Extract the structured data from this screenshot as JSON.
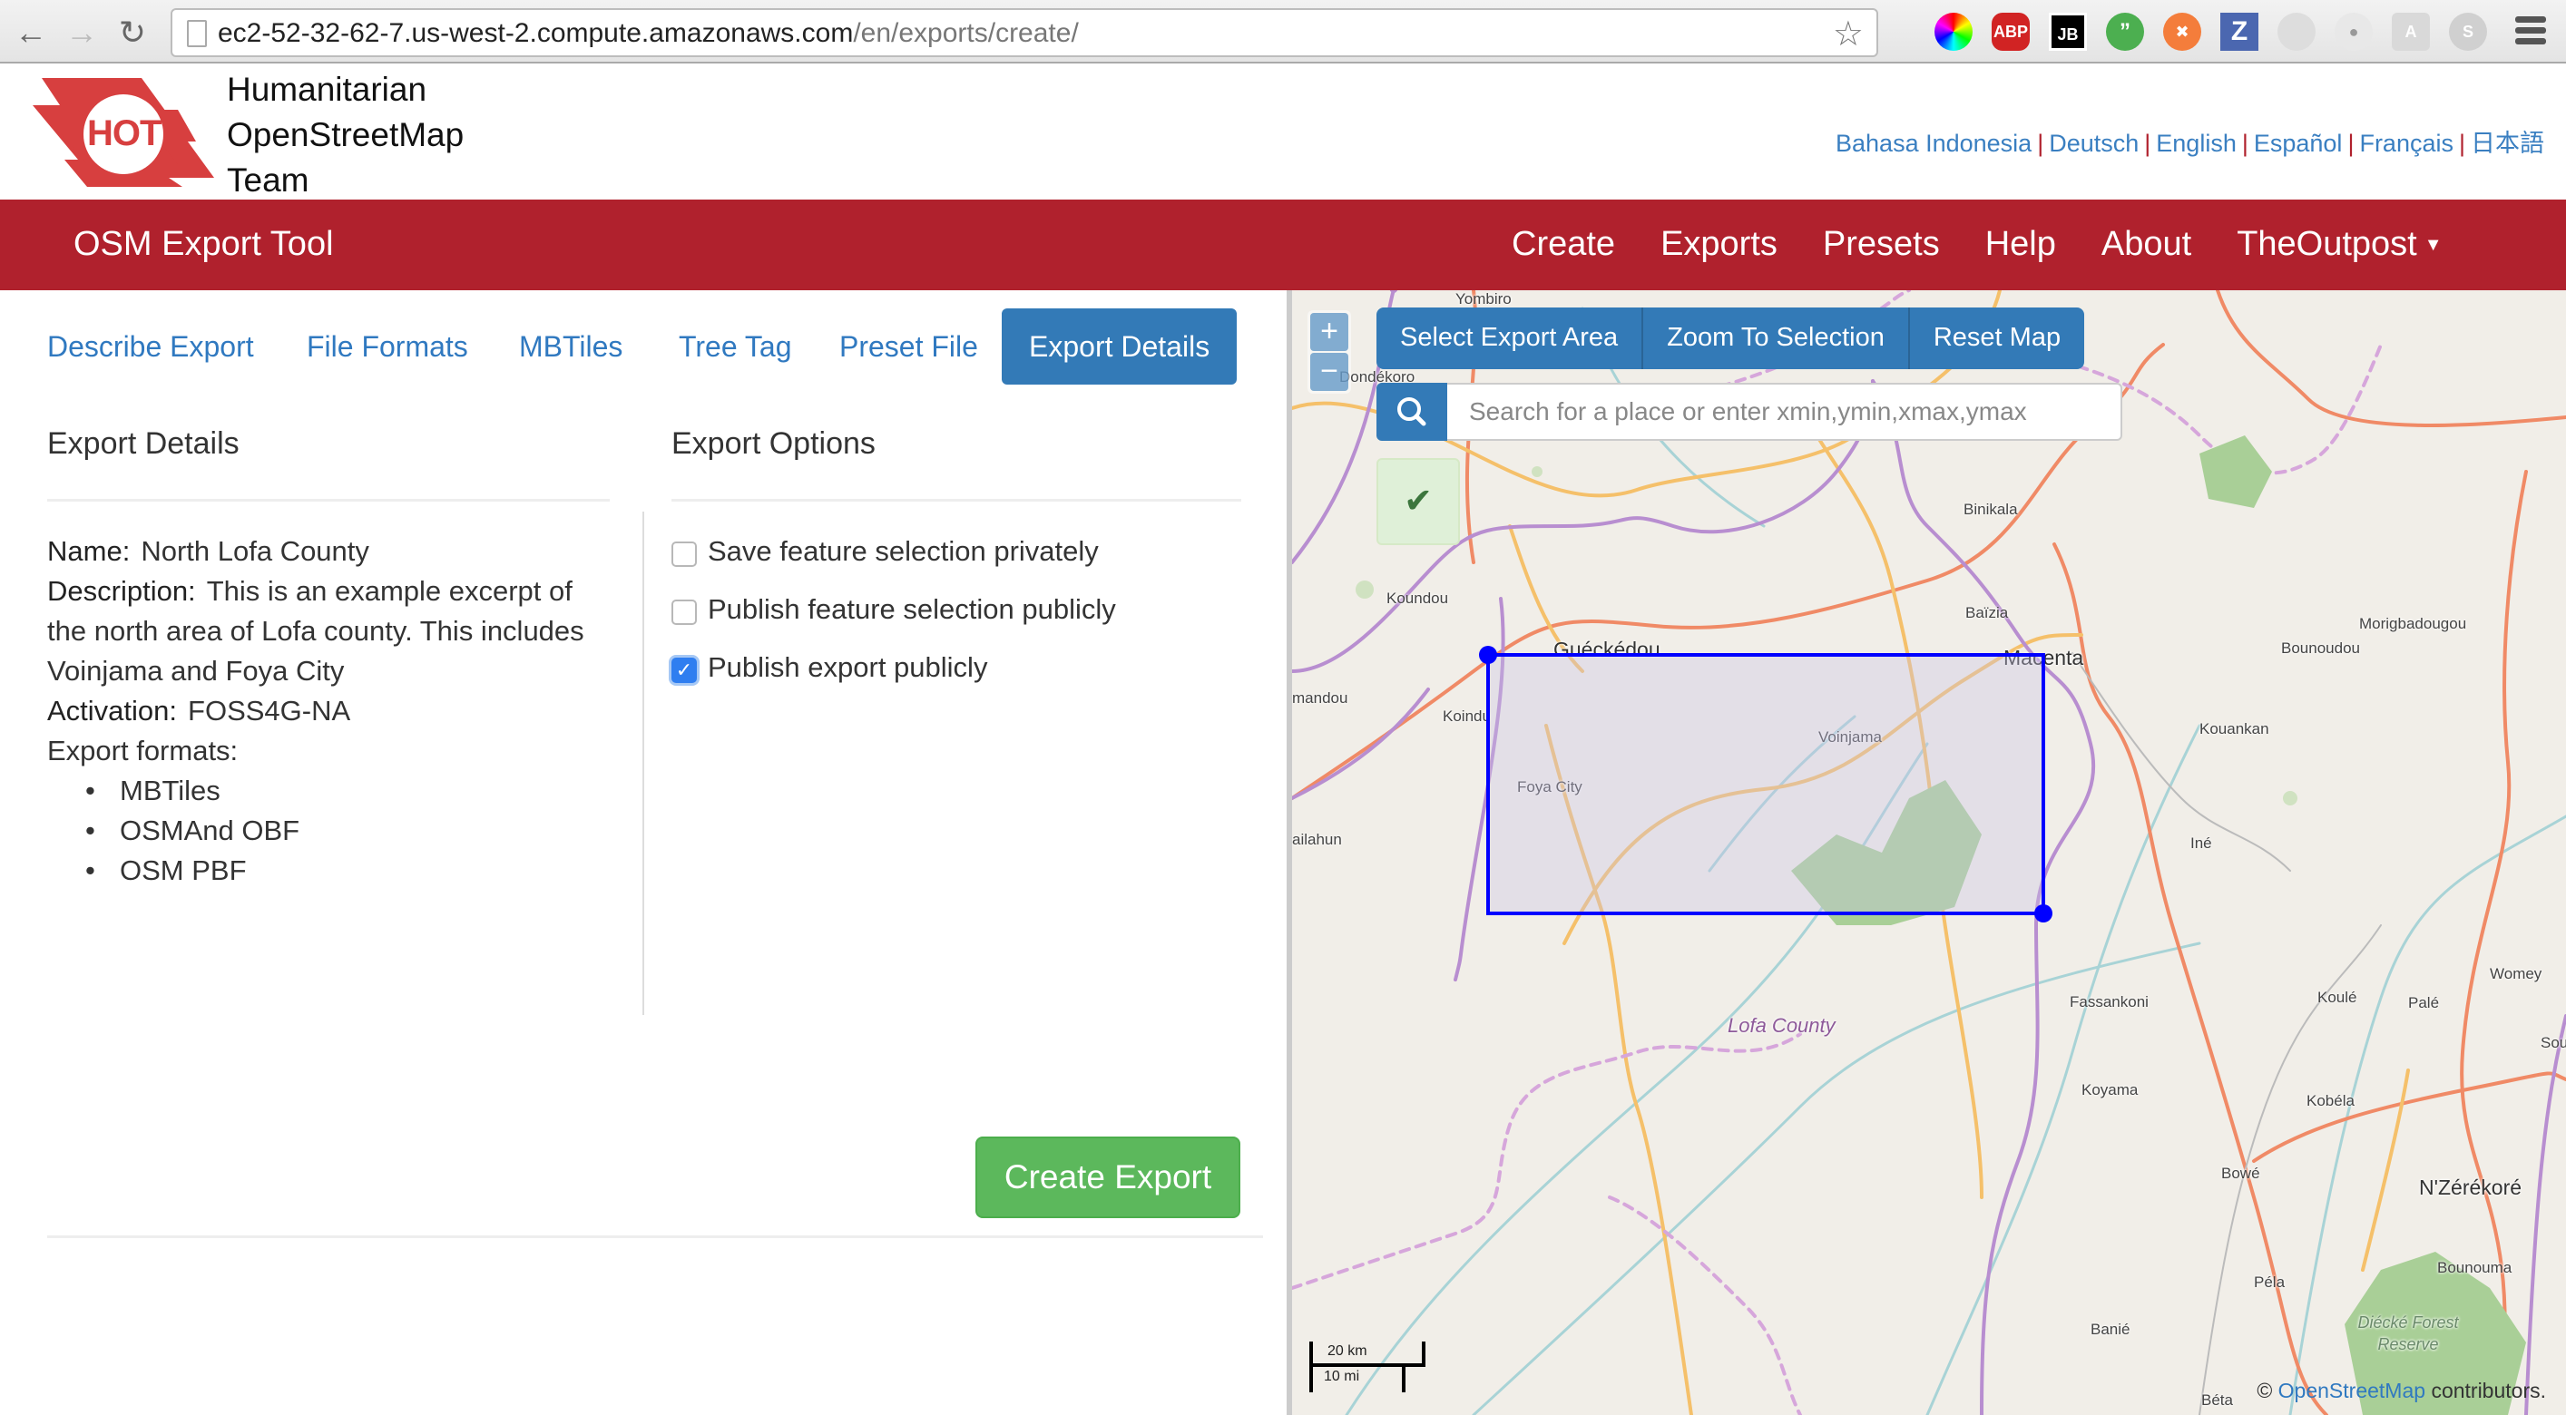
{
  "browser": {
    "url_host": "ec2-52-32-62-7.us-west-2.compute.amazonaws.com",
    "url_path": "/en/exports/create/",
    "extensions": [
      "color-picker-icon",
      "adblock-plus-icon",
      "jetbrains-icon",
      "hangouts-icon",
      "share-icon",
      "zotero-icon",
      "extension-icon",
      "extension-icon",
      "angular-icon",
      "skype-icon"
    ],
    "ext_labels": {
      "abp": "ABP",
      "jb": "JB",
      "z": "Z",
      "a": "A",
      "s": "S"
    }
  },
  "header": {
    "logo_text": "HOT",
    "org_name_lines": [
      "Humanitarian",
      "OpenStreetMap",
      "Team"
    ],
    "languages": [
      "Bahasa Indonesia",
      "Deutsch",
      "English",
      "Español",
      "Français",
      "日本語"
    ]
  },
  "nav": {
    "brand": "OSM Export Tool",
    "links": [
      "Create",
      "Exports",
      "Presets",
      "Help",
      "About",
      "TheOutpost"
    ],
    "colors": {
      "bar": "#b0212d",
      "text": "#ffffff"
    }
  },
  "tabs": {
    "items": [
      "Describe Export",
      "File Formats",
      "MBTiles",
      "Tree Tag",
      "Preset File",
      "Export Details"
    ],
    "active": "Export Details"
  },
  "details": {
    "title": "Export Details",
    "name_label": "Name:",
    "name_value": "North Lofa County",
    "description_label": "Description:",
    "description_lines": [
      "This is an example excerpt of",
      "the north area of Lofa county. This includes",
      "Voinjama and Foya City"
    ],
    "activation_label": "Activation:",
    "activation_value": "FOSS4G-NA",
    "formats_label": "Export formats:",
    "formats": [
      "MBTiles",
      "OSMAnd OBF",
      "OSM PBF"
    ]
  },
  "options": {
    "title": "Export Options",
    "items": [
      {
        "label": "Save feature selection privately",
        "checked": false
      },
      {
        "label": "Publish feature selection publicly",
        "checked": false
      },
      {
        "label": "Publish export publicly",
        "checked": true
      }
    ]
  },
  "actions": {
    "create_export": "Create Export"
  },
  "map": {
    "buttons": [
      "Select Export Area",
      "Zoom To Selection",
      "Reset Map"
    ],
    "search_placeholder": "Search for a place or enter xmin,ymin,xmax,ymax",
    "zoom_in": "+",
    "zoom_out": "−",
    "confirm_icon": "✔",
    "scale_km": "20 km",
    "scale_mi": "10 mi",
    "attribution_prefix": "©",
    "attribution_link": "OpenStreetMap",
    "attribution_suffix": "contributors.",
    "labels": {
      "yombiro": "Yombiro",
      "dondekoro": "Dondékoro",
      "binikala": "Binikala",
      "koundou": "Koundou",
      "baizia": "Baïzia",
      "gueckedou": "Guéckédou",
      "macenta": "Macenta",
      "morigbadougou": "Morigbadougou",
      "bounoudou": "Bounoudou",
      "kamandou": "mandou",
      "koindu": "Koindu",
      "voinjama": "Voinjama",
      "kouankan": "Kouankan",
      "foya": "Foya City",
      "kailahun": "ailahun",
      "ine": "Iné",
      "fassankoni": "Fassankoni",
      "koule": "Koulé",
      "pale": "Palé",
      "womey": "Womey",
      "soulo": "Soulo",
      "lofa": "Lofa County",
      "koyama": "Koyama",
      "kobela": "Kobéla",
      "bowe": "Bowé",
      "nzerekore": "N'Zérékoré",
      "bounouma": "Bounouma",
      "pela": "Péla",
      "banie": "Banié",
      "beta": "Béta",
      "diecke": "Diécké Forest Reserve"
    },
    "selection_color": "#0000ff"
  }
}
